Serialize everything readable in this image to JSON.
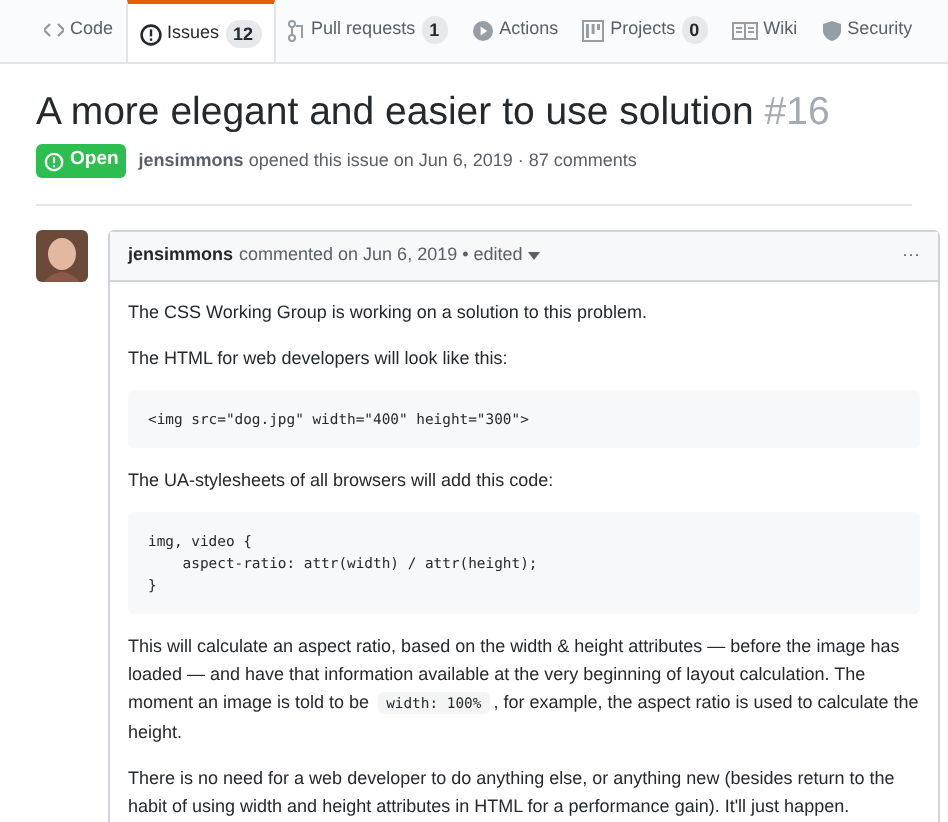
{
  "tabs": [
    {
      "label": "Code",
      "selected": false
    },
    {
      "label": "Issues",
      "count": "12",
      "selected": true
    },
    {
      "label": "Pull requests",
      "count": "1",
      "selected": false
    },
    {
      "label": "Actions",
      "selected": false
    },
    {
      "label": "Projects",
      "count": "0",
      "selected": false
    },
    {
      "label": "Wiki",
      "selected": false
    },
    {
      "label": "Security",
      "selected": false
    }
  ],
  "issue": {
    "title": "A more elegant and easier to use solution",
    "number": "#16",
    "state": "Open",
    "author": "jensimmons",
    "meta": "opened this issue on Jun 6, 2019 · 87 comments"
  },
  "comment": {
    "author": "jensimmons",
    "meta": "commented on Jun 6, 2019 • edited",
    "menu": "···",
    "body": [
      {
        "kind": "paragraph",
        "parts": [
          {
            "kind": "text",
            "text": "The CSS Working Group is working on a solution to this problem."
          }
        ]
      },
      {
        "kind": "paragraph",
        "parts": [
          {
            "kind": "text",
            "text": "The HTML for web developers will look like this:"
          }
        ]
      },
      {
        "kind": "code",
        "text": "<img src=\"dog.jpg\" width=\"400\" height=\"300\">"
      },
      {
        "kind": "paragraph",
        "parts": [
          {
            "kind": "text",
            "text": "The UA-stylesheets of all browsers will add this code:"
          }
        ]
      },
      {
        "kind": "code",
        "text": "img, video {\n    aspect-ratio: attr(width) / attr(height);\n}"
      },
      {
        "kind": "paragraph",
        "parts": [
          {
            "kind": "text",
            "text": "This will calculate an aspect ratio, based on the width & height attributes — before the image has loaded — and have that information available at the very beginning of layout calculation. The moment an image is told to be "
          },
          {
            "kind": "code",
            "text": "width: 100%"
          },
          {
            "kind": "text",
            "text": ", for example, the aspect ratio is used to calculate the height."
          }
        ]
      },
      {
        "kind": "paragraph",
        "parts": [
          {
            "kind": "text",
            "text": "There is no need for a web developer to do anything else, or anything new (besides return to the habit of using width and height attributes in HTML for a performance gain). It'll just happen."
          }
        ]
      }
    ]
  }
}
